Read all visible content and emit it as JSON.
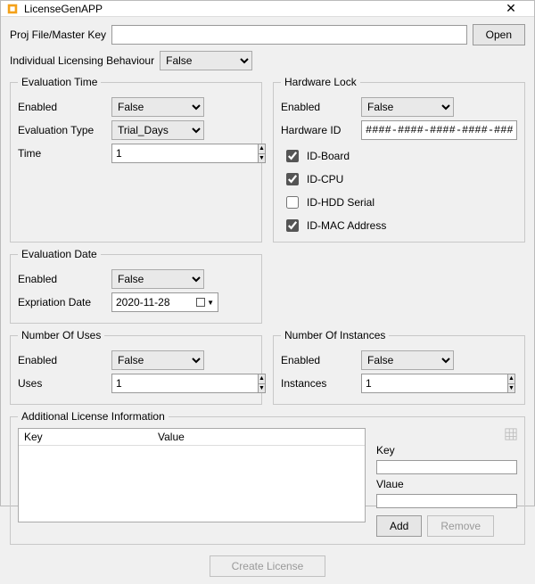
{
  "window": {
    "title": "LicenseGenAPP"
  },
  "topbar": {
    "proj_label": "Proj File/Master Key",
    "open_btn": "Open"
  },
  "ilb": {
    "label": "Individual Licensing Behaviour",
    "value": "False"
  },
  "eval_time": {
    "legend": "Evaluation Time",
    "enabled_label": "Enabled",
    "enabled_value": "False",
    "type_label": "Evaluation Type",
    "type_value": "Trial_Days",
    "time_label": "Time",
    "time_value": "1"
  },
  "hw_lock": {
    "legend": "Hardware Lock",
    "enabled_label": "Enabled",
    "enabled_value": "False",
    "hwid_label": "Hardware ID",
    "hwid_value": "####-####-####-####-####",
    "cb_board": {
      "label": "ID-Board",
      "checked": true
    },
    "cb_cpu": {
      "label": "ID-CPU",
      "checked": true
    },
    "cb_hdd": {
      "label": "ID-HDD Serial",
      "checked": false
    },
    "cb_mac": {
      "label": "ID-MAC Address",
      "checked": true
    }
  },
  "eval_date": {
    "legend": "Evaluation Date",
    "enabled_label": "Enabled",
    "enabled_value": "False",
    "exp_label": "Expriation Date",
    "exp_value": "2020-11-28"
  },
  "num_uses": {
    "legend": "Number Of Uses",
    "enabled_label": "Enabled",
    "enabled_value": "False",
    "uses_label": "Uses",
    "uses_value": "1"
  },
  "num_inst": {
    "legend": "Number Of Instances",
    "enabled_label": "Enabled",
    "enabled_value": "False",
    "inst_label": "Instances",
    "inst_value": "1"
  },
  "addl": {
    "legend": "Additional License Information",
    "col_key": "Key",
    "col_value": "Value",
    "side_key_label": "Key",
    "side_value_label": "Vlaue",
    "add_btn": "Add",
    "remove_btn": "Remove"
  },
  "bottom": {
    "create_btn": "Create License"
  }
}
